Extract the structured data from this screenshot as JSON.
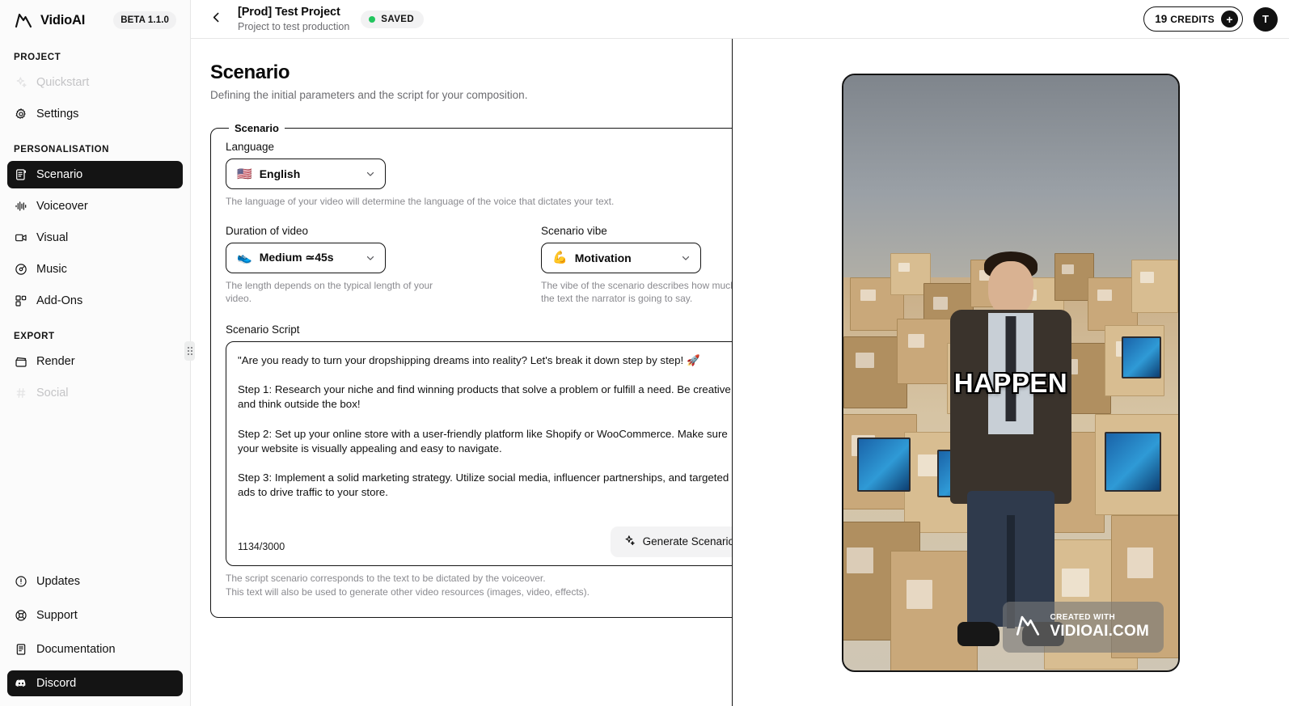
{
  "sidebar": {
    "brand": {
      "name": "VidioAI",
      "badge": "BETA 1.1.0",
      "logo_icon": "mountain-logo-icon"
    },
    "sections": [
      {
        "title": "PROJECT",
        "items": [
          {
            "label": "Quickstart",
            "icon": "sparkles-icon",
            "state": "disabled"
          },
          {
            "label": "Settings",
            "icon": "gear-icon",
            "state": "normal"
          }
        ]
      },
      {
        "title": "PERSONALISATION",
        "items": [
          {
            "label": "Scenario",
            "icon": "script-icon",
            "state": "active"
          },
          {
            "label": "Voiceover",
            "icon": "waveform-icon",
            "state": "normal"
          },
          {
            "label": "Visual",
            "icon": "video-camera-icon",
            "state": "normal"
          },
          {
            "label": "Music",
            "icon": "disc-icon",
            "state": "normal"
          },
          {
            "label": "Add-Ons",
            "icon": "blocks-icon",
            "state": "normal"
          }
        ]
      },
      {
        "title": "EXPORT",
        "items": [
          {
            "label": "Render",
            "icon": "clapperboard-icon",
            "state": "normal"
          },
          {
            "label": "Social",
            "icon": "hash-icon",
            "state": "disabled"
          }
        ]
      }
    ],
    "bottom_items": [
      {
        "label": "Updates",
        "icon": "alert-circle-icon",
        "state": "normal"
      },
      {
        "label": "Support",
        "icon": "lifebuoy-icon",
        "state": "normal"
      },
      {
        "label": "Documentation",
        "icon": "document-icon",
        "state": "normal"
      },
      {
        "label": "Discord",
        "icon": "discord-icon",
        "state": "active"
      }
    ]
  },
  "topbar": {
    "back_icon": "chevron-left-icon",
    "project_title": "[Prod] Test Project",
    "project_subtitle": "Project to test production",
    "status": "SAVED",
    "status_color": "#22c55e",
    "credits_count": "19",
    "credits_label": "CREDITS",
    "credits_plus": "+",
    "avatar_initial": "T"
  },
  "page": {
    "title": "Scenario",
    "subtitle": "Defining the initial parameters and the script for your composition."
  },
  "form": {
    "legend": "Scenario",
    "language": {
      "label": "Language",
      "value": "English",
      "flag": "🇺🇸",
      "hint": "The language of your video will determine the language of the voice that dictates your text."
    },
    "duration": {
      "label": "Duration of video",
      "value": "Medium  ≃45s",
      "emoji": "👟",
      "hint": "The length depends on the typical length of your video."
    },
    "vibe": {
      "label": "Scenario vibe",
      "value": "Motivation",
      "emoji": "💪",
      "hint": "The vibe of the scenario describes how much of the text the narrator is going to say."
    },
    "script": {
      "label": "Scenario Script",
      "value": "\"Are you ready to turn your dropshipping dreams into reality? Let's break it down step by step! 🚀\n\nStep 1: Research your niche and find winning products that solve a problem or fulfill a need. Be creative and think outside the box!\n\nStep 2: Set up your online store with a user-friendly platform like Shopify or WooCommerce. Make sure your website is visually appealing and easy to navigate.\n\nStep 3: Implement a solid marketing strategy. Utilize social media, influencer partnerships, and targeted ads to drive traffic to your store.",
      "counter": "1134/3000",
      "generate_button": "Generate Scenario",
      "generate_icon": "sparkles-icon",
      "hint_line1": "The script scenario corresponds to the text to be dictated by the voiceover.",
      "hint_line2": "This text will also be used to generate other video resources (images, video, effects)."
    }
  },
  "preview": {
    "caption_text": "HAPPEN",
    "watermark_small": "CREATED WITH",
    "watermark_big": "VIDIOAI.COM",
    "watermark_icon": "mountain-logo-icon"
  }
}
